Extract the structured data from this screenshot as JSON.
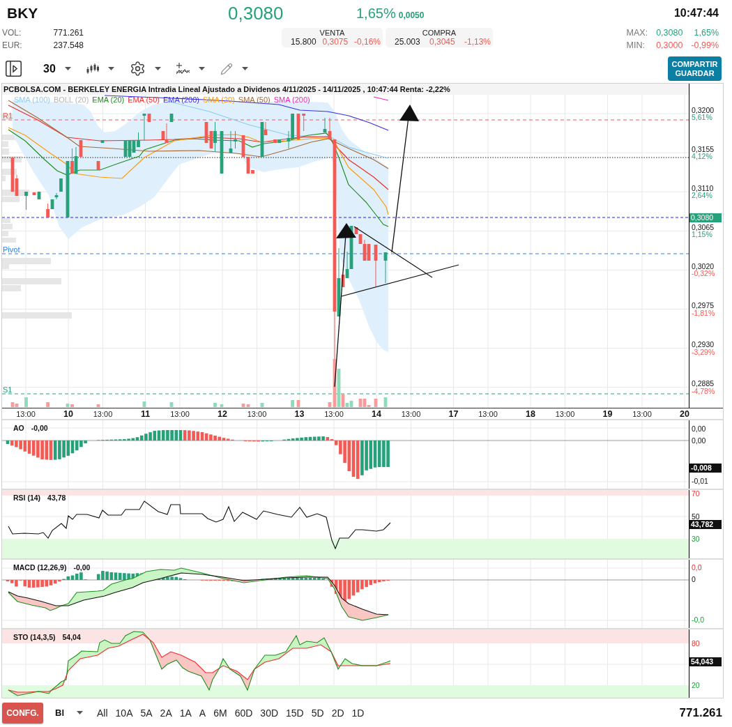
{
  "header": {
    "symbol": "BKY",
    "price": "0,3080",
    "change_percent": "1,65%",
    "change": "0,0050",
    "rising": true,
    "time": "10:47:44"
  },
  "stats": [
    {
      "label": "VOL:",
      "value": "771.261"
    },
    {
      "label": "EUR:",
      "value": "237.548"
    }
  ],
  "quotes": [
    {
      "title": "VENTA",
      "volume": "15.800",
      "price": "0,3075",
      "change": "-0,16%",
      "rising": false
    },
    {
      "title": "COMPRA",
      "volume": "25.003",
      "price": "0,3045",
      "change": "-1,13%",
      "rising": false
    }
  ],
  "range": [
    {
      "label": "MAX:",
      "price": "0,3080",
      "change": "1,65%",
      "rising": true
    },
    {
      "label": "MIN:",
      "price": "0,3000",
      "change": "-0,99%",
      "rising": false
    }
  ],
  "toolbar": {
    "interval": "30",
    "share_button": [
      "COMPARTIR",
      "GUARDAR"
    ]
  },
  "chart": {
    "title": "PCBOLSA.COM - BERKELEY ENERGIA Intradia Lineal Ajustado a Dividenos 4/11/2025 - 14/11/2025 , 10:47:44 Renta: -2,22%",
    "legend": [
      {
        "label": "SMA (100)",
        "color": "#8ccbf2"
      },
      {
        "label": "BOLL (20)",
        "color": "#b4b4b4"
      },
      {
        "label": "EMA (20)",
        "color": "#1e8f1e"
      },
      {
        "label": "EMA (50)",
        "color": "#f22a2a"
      },
      {
        "label": "EMA (200)",
        "color": "#3a2ee8"
      },
      {
        "label": "SMA (20)",
        "color": "#ff9a0a"
      },
      {
        "label": "SMA (50)",
        "color": "#a86a36"
      },
      {
        "label": "SMA (200)",
        "color": "#ee22c0"
      }
    ],
    "levels": [
      {
        "label": "R1",
        "kind": "resistance"
      },
      {
        "label": "Pivot",
        "kind": "pivot"
      },
      {
        "label": "S1",
        "kind": "support"
      }
    ],
    "price_axis": [
      {
        "price": "0,3200",
        "change": "5,61%",
        "rising": true
      },
      {
        "price": "0,3155",
        "change": "4,12%",
        "rising": true
      },
      {
        "price": "0,3110",
        "change": "2,64%",
        "rising": true
      },
      {
        "price": "0,3065",
        "change": "1,15%",
        "rising": true
      },
      {
        "price": "0,3020",
        "change": "-0,32%",
        "rising": false
      },
      {
        "price": "0,2975",
        "change": "-1,81%",
        "rising": false
      },
      {
        "price": "0,2930",
        "change": "-3,29%",
        "rising": false
      },
      {
        "price": "0,2885",
        "change": "-4,78%",
        "rising": false
      }
    ],
    "last_price": "0,3080",
    "day_labels": [
      "10",
      "11",
      "12",
      "13",
      "14",
      "17",
      "18",
      "19",
      "20"
    ],
    "hour_labels": [
      "13:00",
      "13:00",
      "13:00",
      "13:00",
      "13:00",
      "13:00",
      "13:00",
      "13:00",
      "13:00"
    ]
  },
  "indicators": [
    {
      "kind": "ao",
      "label": "AO",
      "value": "-0,00",
      "ticks": [
        {
          "text": "0,00",
          "kind": "neutral"
        },
        {
          "text": "0,00",
          "kind": "neutral"
        },
        {
          "text": "-0,01",
          "kind": "neutral"
        }
      ],
      "badge": "-0,008"
    },
    {
      "kind": "rsi",
      "label": "RSI (14)",
      "value": "43,78",
      "ticks": [
        {
          "text": "70",
          "kind": "overbought"
        },
        {
          "text": "50",
          "kind": "neutral"
        },
        {
          "text": "30",
          "kind": "oversold"
        }
      ],
      "badge": "43,782"
    },
    {
      "kind": "macd",
      "label": "MACD (12,26,9)",
      "value": "-0,00",
      "ticks": [
        {
          "text": "0,0",
          "kind": "overbought"
        },
        {
          "text": "0",
          "kind": "neutral"
        },
        {
          "text": "-0,0",
          "kind": "oversold"
        }
      ]
    },
    {
      "kind": "sto",
      "label": "STO (14,3,5)",
      "value": "54,04",
      "ticks": [
        {
          "text": "80",
          "kind": "overbought"
        },
        {
          "text": "20",
          "kind": "oversold"
        }
      ],
      "badge": "54,043"
    }
  ],
  "bottom_bar": {
    "config_button": "CONFG.",
    "chart_style": "Bl",
    "periods": [
      "All",
      "10A",
      "5A",
      "2A",
      "1A",
      "A",
      "6M",
      "60D",
      "30D",
      "15D",
      "5D",
      "2D",
      "1D"
    ],
    "volume": "771.261"
  }
}
